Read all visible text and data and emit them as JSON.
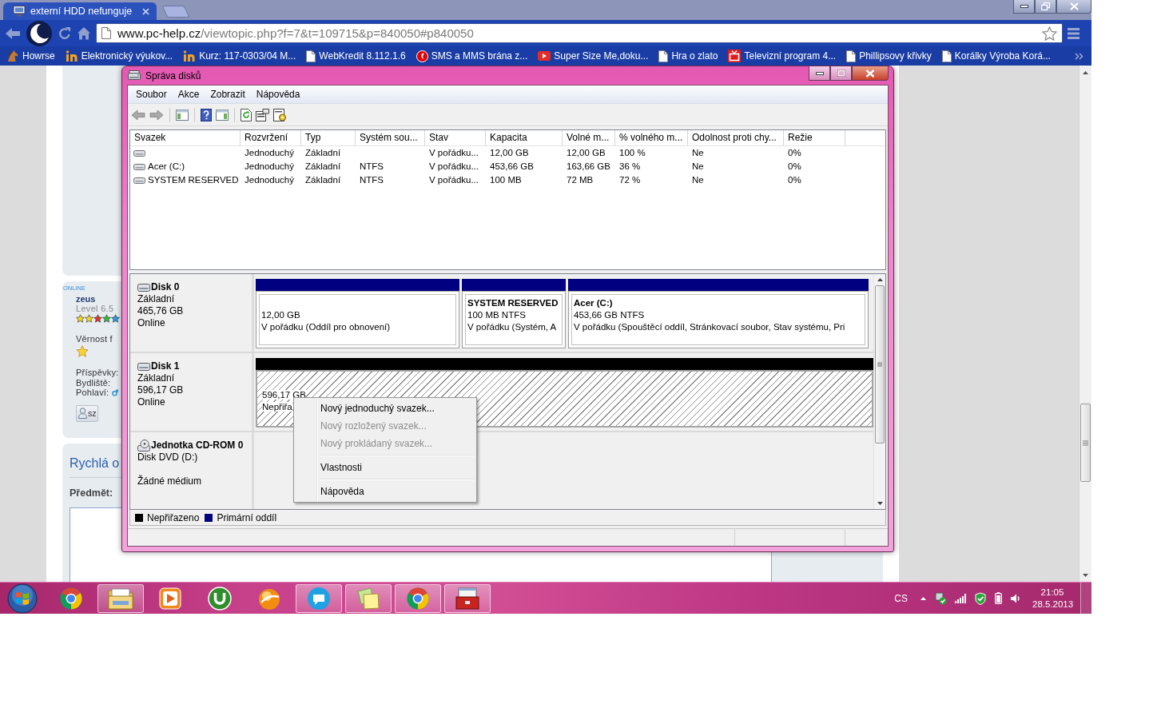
{
  "browser": {
    "tabs": [
      {
        "title": "externí HDD nefunguje",
        "selected": true
      }
    ],
    "url": {
      "domain": "www.pc-help.cz",
      "path": "/viewtopic.php?f=7&t=109715&p=840050#p840050"
    },
    "bookmarks": [
      {
        "label": "Howrse",
        "kind": "horse"
      },
      {
        "label": "Elektronický výukov...",
        "kind": "logo"
      },
      {
        "label": "Kurz: 117-0303/04 M...",
        "kind": "logo"
      },
      {
        "label": "WebKredit 8.112.1.6",
        "kind": "page"
      },
      {
        "label": "SMS a MMS brána z...",
        "kind": "operator"
      },
      {
        "label": "Super Size Me,doku...",
        "kind": "video"
      },
      {
        "label": "Hra o zlato",
        "kind": "page"
      },
      {
        "label": "Televizní program 4...",
        "kind": "tv"
      },
      {
        "label": "Phillipsovy křivky",
        "kind": "page"
      },
      {
        "label": "Korálky Výroba Korá...",
        "kind": "page"
      }
    ]
  },
  "forum": {
    "online": "ONLINE",
    "username": "zeus",
    "level": "Level 6.5",
    "loyalty": "Věrnost f",
    "profile": [
      "Příspěvky:",
      "Bydliště:",
      "Pohlaví:"
    ],
    "profile_button": "sz",
    "quick_reply": {
      "title": "Rychlá o",
      "subject_label": "Předmět:"
    }
  },
  "disk_window": {
    "title": "Správa disků",
    "menu": [
      "Soubor",
      "Akce",
      "Zobrazit",
      "Nápověda"
    ],
    "volumes": {
      "columns": [
        "Svazek",
        "Rozvržení",
        "Typ",
        "Systém sou...",
        "Stav",
        "Kapacita",
        "Volné m...",
        "% volného m...",
        "Odolnost proti chy...",
        "Režie"
      ],
      "rows": [
        {
          "layout": "Jednoduchý",
          "type": "Základní",
          "status": "V pořádku...",
          "capacity": "12,00 GB",
          "free": "12,00 GB",
          "free_pct": "100 %",
          "fault_tolerance": "Ne",
          "overhead": "0%"
        },
        {
          "volume": "Acer (C:)",
          "layout": "Jednoduchý",
          "type": "Základní",
          "file_system": "NTFS",
          "status": "V pořádku...",
          "capacity": "453,66 GB",
          "free": "163,66 GB",
          "free_pct": "36 %",
          "fault_tolerance": "Ne",
          "overhead": "0%"
        },
        {
          "volume": "SYSTEM RESERVED",
          "layout": "Jednoduchý",
          "type": "Základní",
          "file_system": "NTFS",
          "status": "V pořádku...",
          "capacity": "100 MB",
          "free": "72 MB",
          "free_pct": "72 %",
          "fault_tolerance": "Ne",
          "overhead": "0%"
        }
      ]
    },
    "disks": [
      {
        "kind": "disk",
        "name": "Disk 0",
        "details": [
          "Základní",
          "465,76 GB",
          "Online"
        ],
        "partitions": [
          {
            "kind": "primary",
            "size": "12,00 GB",
            "status": "V pořádku (Oddíl pro obnovení)"
          },
          {
            "kind": "primary",
            "label": "SYSTEM RESERVED",
            "size": "100 MB NTFS",
            "status": "V pořádku (Systém, A"
          },
          {
            "kind": "primary",
            "label": "Acer  (C:)",
            "size": "453,66 GB NTFS",
            "status": "V pořádku (Spouštěcí oddíl, Stránkovací soubor, Stav systému, Pri"
          }
        ]
      },
      {
        "kind": "disk",
        "name": "Disk 1",
        "details": [
          "Základní",
          "596,17 GB",
          "Online"
        ],
        "partitions": [
          {
            "kind": "unallocated",
            "size": "596,17 GB",
            "status": "Nepřiřa"
          }
        ]
      },
      {
        "kind": "cdrom",
        "name": "Jednotka CD-ROM 0",
        "details": [
          "Disk DVD (D:)",
          "Žádné médium"
        ]
      }
    ],
    "legend": [
      {
        "kind": "unallocated",
        "label": "Nepřiřazeno",
        "color": "#000000"
      },
      {
        "kind": "primary",
        "label": "Primární oddíl",
        "color": "#000080"
      }
    ],
    "context_menu": {
      "groups": [
        [
          {
            "label": "Nový jednoduchý svazek...",
            "disabled": false
          },
          {
            "label": "Nový rozložený svazek...",
            "disabled": true
          },
          {
            "label": "Nový prokládaný svazek...",
            "disabled": true
          }
        ],
        [
          {
            "label": "Vlastnosti",
            "disabled": false
          }
        ],
        [
          {
            "label": "Nápověda",
            "disabled": false
          }
        ]
      ]
    }
  },
  "taskbar": {
    "apps": [
      {
        "kind": "browser",
        "running": false
      },
      {
        "kind": "explorer",
        "running": true
      },
      {
        "kind": "media",
        "running": false
      },
      {
        "kind": "torrent",
        "running": false
      },
      {
        "kind": "sphere",
        "running": false
      },
      {
        "kind": "chat",
        "running": true
      },
      {
        "kind": "notes",
        "running": true
      },
      {
        "kind": "browser",
        "running": true
      },
      {
        "kind": "toolbox",
        "running": true
      }
    ],
    "language": "CS",
    "time": "21:05",
    "date": "28.5.2013"
  }
}
